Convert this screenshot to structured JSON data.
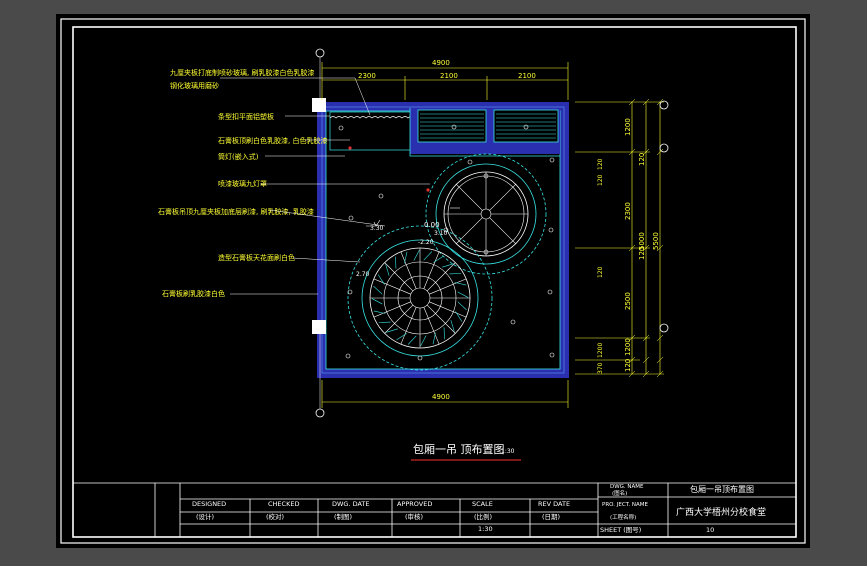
{
  "drawing": {
    "title": "包厢一吊 顶布置图",
    "scale_label": "1:30",
    "colors": {
      "background": "#000000",
      "border": "#ffffff",
      "wall": "#4a6fd8",
      "fill_blue": "#2a2fb0",
      "cyan": "#39e6e6",
      "dimension": "#ffff33",
      "annotation": "#ffff33",
      "red": "#e03030",
      "light": "#ffffff",
      "title_underline": "#ff3030"
    },
    "annotations": [
      "九厘夹板打底制喷砂玻璃, 刷乳胶漆白色乳胶漆",
      "钢化玻璃用磨砂",
      "条型扣平面铝塑板",
      "石膏板顶刷白色乳胶漆, 白色乳胶漆",
      "筒灯(嵌入式)",
      "喷漆玻璃九灯罩",
      "石膏板吊顶九厘夹板加底层刷漆, 刷乳胶漆, 乳胶漆",
      "造型石膏板天花面刷白色",
      "石膏板刷乳胶漆白色"
    ],
    "dimensions_top": {
      "total": "4900",
      "parts": [
        "2300",
        "2100",
        "2100"
      ]
    },
    "dimensions_bottom": {
      "total": "4900"
    },
    "dimensions_right": {
      "total": "5500",
      "parts": [
        "1200",
        "120",
        "2300",
        "120",
        "2500",
        "1200",
        "120"
      ],
      "inner": [
        "120",
        "1200",
        "2300",
        "120",
        "2500",
        "120",
        "1200",
        "370"
      ],
      "mid": "5000"
    },
    "markers": [
      "0.00",
      "3.10",
      "-2.20",
      "2.70",
      "3.30"
    ]
  },
  "title_block": {
    "headers": [
      "DESIGNED",
      "CHECKED",
      "DWG. DATE",
      "APPROVED",
      "SCALE",
      "REV DATE"
    ],
    "values": [
      "(设计)",
      "(校对)",
      "(制图)",
      "(审核)",
      "(比例)",
      "(日期)"
    ],
    "scale_value": "1:30",
    "dwg_name_label": "DWG. NAME",
    "dwg_name_sub": "(图名)",
    "dwg_name": "包厢一吊顶布置图",
    "project_label": "PRO. JECT. NAME",
    "project_sub": "(工程名称)",
    "project_name": "广西大学梧州分校食堂",
    "sheet_label": "SHEET (图号)",
    "sheet_value": "10"
  }
}
